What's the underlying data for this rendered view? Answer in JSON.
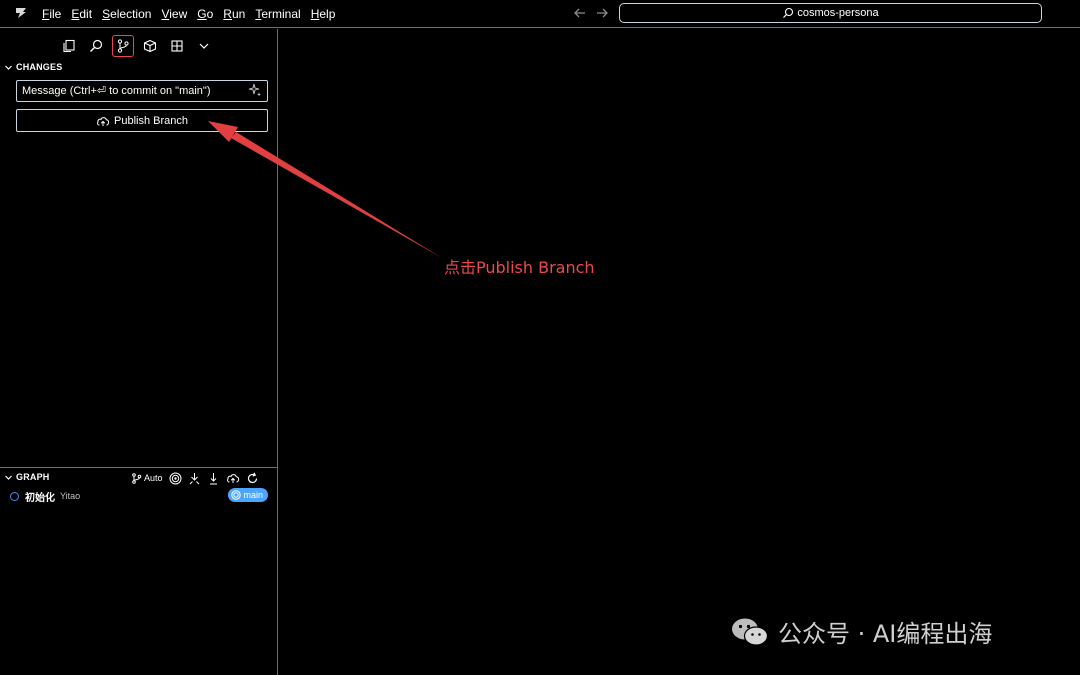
{
  "titlebar": {
    "menu": [
      "File",
      "Edit",
      "Selection",
      "View",
      "Go",
      "Run",
      "Terminal",
      "Help"
    ],
    "search_text": "cosmos-persona",
    "nav_back_icon": "arrow-left-icon",
    "nav_forward_icon": "arrow-right-icon"
  },
  "activity_bar": {
    "icons": [
      "explorer-icon",
      "search-icon",
      "source-control-icon",
      "extensions-icon",
      "layout-icon",
      "chevron-down-icon"
    ],
    "active": "source-control-icon"
  },
  "changes": {
    "header": "CHANGES",
    "message_placeholder": "Message (Ctrl+⏎ to commit on \"main\")",
    "publish_label": "Publish Branch"
  },
  "graph": {
    "header": "GRAPH",
    "auto_label": "Auto",
    "commit": {
      "message": "初始化",
      "author": "Yitao",
      "branch": "main"
    }
  },
  "annotation": {
    "text": "点击Publish Branch",
    "color": "#e84b4b"
  },
  "watermark": {
    "text": "公众号 · AI编程出海"
  },
  "colors": {
    "background": "#000000",
    "border": "#5f6f85",
    "badge": "#4ca6ff",
    "active_icon_border": "#e5484d"
  }
}
